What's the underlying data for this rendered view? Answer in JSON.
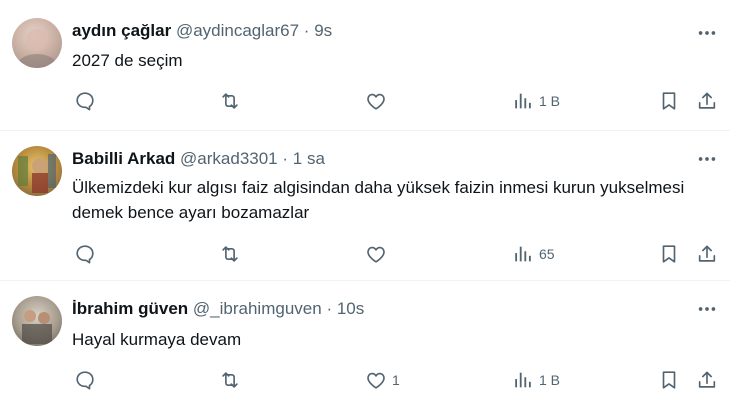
{
  "tweets": [
    {
      "display_name": "aydın çağlar",
      "handle": "@aydincaglar67",
      "separator": "·",
      "time": "9s",
      "text": "2027 de seçim",
      "likes": "",
      "views": "1 B"
    },
    {
      "display_name": "Babilli Arkad",
      "handle": "@arkad3301",
      "separator": "·",
      "time": "1 sa",
      "text": "Ülkemizdeki kur algısı faiz algisindan daha yüksek faizin inmesi kurun yukselmesi demek bence ayarı bozamazlar",
      "likes": "",
      "views": "65"
    },
    {
      "display_name": "İbrahim güven",
      "handle": "@_ibrahimguven",
      "separator": "·",
      "time": "10s",
      "text": "Hayal kurmaya devam",
      "likes": "1",
      "views": "1 B"
    }
  ],
  "colors": {
    "secondary_text": "#536471",
    "primary_text": "#0f1419",
    "divider": "#eff3f4"
  },
  "icons": [
    "more-icon",
    "reply-icon",
    "retweet-icon",
    "like-icon",
    "views-icon",
    "bookmark-icon",
    "share-icon"
  ]
}
